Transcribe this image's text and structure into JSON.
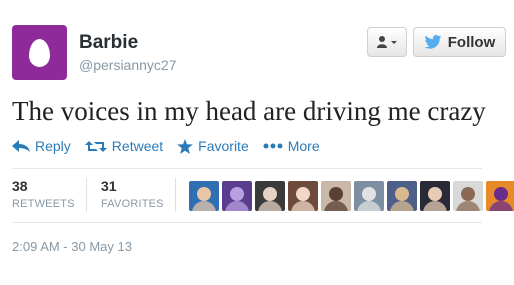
{
  "profile": {
    "display_name": "Barbie",
    "screen_name": "@persiannyc27",
    "avatar_color": "#8e2a9a"
  },
  "header_buttons": {
    "user_menu_icon": "user-icon",
    "follow_label": "Follow",
    "follow_icon": "twitter-bird-icon"
  },
  "tweet": {
    "text": "The voices in my head are driving me crazy"
  },
  "actions": [
    {
      "label": "Reply",
      "icon": "reply-icon"
    },
    {
      "label": "Retweet",
      "icon": "retweet-icon"
    },
    {
      "label": "Favorite",
      "icon": "star-icon"
    },
    {
      "label": "More",
      "icon": "more-dots-icon"
    }
  ],
  "stats": {
    "retweets": {
      "count": "38",
      "label": "RETWEETS"
    },
    "favorites": {
      "count": "31",
      "label": "FAVORITES"
    }
  },
  "favoriters": [
    {
      "bg": "#2f6fb2",
      "fg": "#e8c6a8"
    },
    {
      "bg": "#5b3d8f",
      "fg": "#b9a0e0"
    },
    {
      "bg": "#3a3a3a",
      "fg": "#e6d2c4"
    },
    {
      "bg": "#6e4a3a",
      "fg": "#f0d7c6"
    },
    {
      "bg": "#c9b7a8",
      "fg": "#5a4030"
    },
    {
      "bg": "#7c8fa3",
      "fg": "#e2e2e2"
    },
    {
      "bg": "#4e5f8a",
      "fg": "#d7b98e"
    },
    {
      "bg": "#2a2a36",
      "fg": "#e7cbb7"
    },
    {
      "bg": "#d9d9d9",
      "fg": "#8a6a55"
    },
    {
      "bg": "#e88a2a",
      "fg": "#6a2c8a"
    }
  ],
  "timestamp": "2:09 AM - 30 May 13",
  "colors": {
    "link_blue": "#2b7bb9",
    "muted": "#8899a6",
    "bird_blue": "#55acee"
  }
}
